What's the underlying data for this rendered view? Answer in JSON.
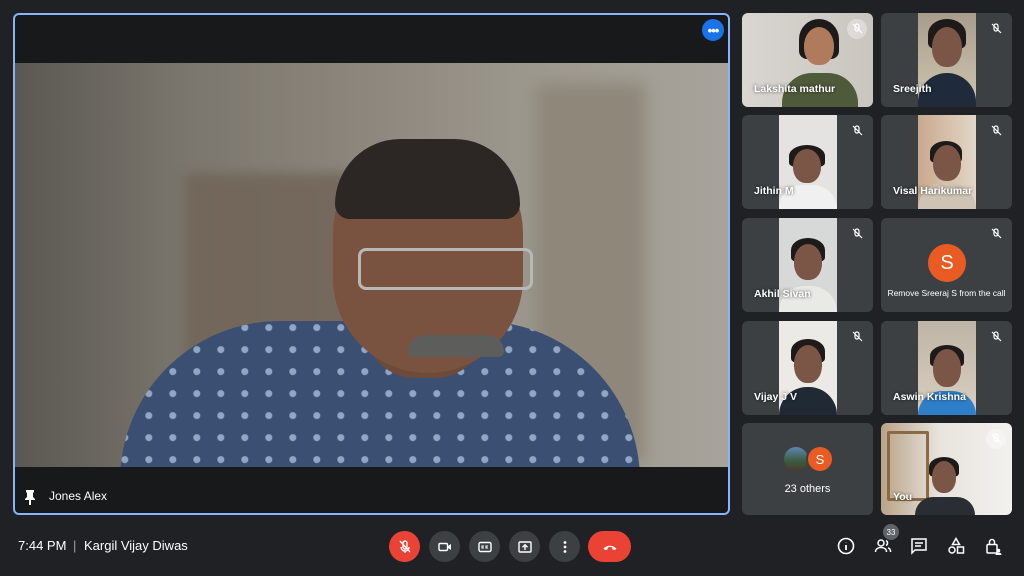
{
  "main": {
    "speaker_name": "Jones Alex",
    "menu_icon": "more-horiz-icon",
    "pin_icon": "pin-icon"
  },
  "participants": [
    {
      "name": "Lakshita mathur",
      "muted": true
    },
    {
      "name": "Sreejith",
      "muted": true
    },
    {
      "name": "Jithin M",
      "muted": true
    },
    {
      "name": "Visal Harikumar",
      "muted": true
    },
    {
      "name": "Akhil Sivan",
      "muted": true
    },
    {
      "name": "Sreeraj S",
      "avatar_letter": "S",
      "tooltip": "Remove Sreeraj S from the call",
      "muted": true
    },
    {
      "name": "Vijay J V",
      "muted": true
    },
    {
      "name": "Aswin Krishna",
      "muted": true
    },
    {
      "name": "others",
      "avatar_letter": "S",
      "label": "23 others"
    },
    {
      "name": "You",
      "muted": true
    }
  ],
  "bottom_bar": {
    "time": "7:44 PM",
    "separator": "|",
    "meeting_name": "Kargil Vijay Diwas",
    "people_count": "33"
  },
  "colors": {
    "background": "#202124",
    "tile": "#3c4043",
    "active_border": "#8ab4f8",
    "danger": "#ea4335",
    "avatar_orange": "#ea5b24"
  }
}
